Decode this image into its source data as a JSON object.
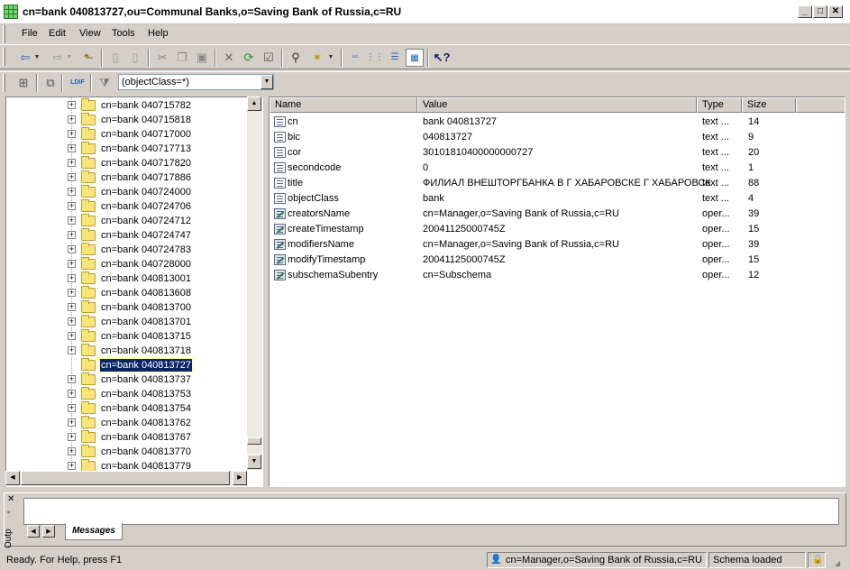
{
  "window": {
    "title": "cn=bank 040813727,ou=Communal Banks,o=Saving Bank of Russia,c=RU"
  },
  "menu": [
    {
      "label": "File"
    },
    {
      "label": "Edit"
    },
    {
      "label": "View"
    },
    {
      "label": "Tools"
    },
    {
      "label": "Help"
    }
  ],
  "filter": {
    "value": "(objectClass=*)",
    "ldif_label": "LDIF"
  },
  "tree": {
    "items": [
      {
        "label": "cn=bank 040715782"
      },
      {
        "label": "cn=bank 040715818"
      },
      {
        "label": "cn=bank 040717000"
      },
      {
        "label": "cn=bank 040717713"
      },
      {
        "label": "cn=bank 040717820"
      },
      {
        "label": "cn=bank 040717886"
      },
      {
        "label": "cn=bank 040724000"
      },
      {
        "label": "cn=bank 040724706"
      },
      {
        "label": "cn=bank 040724712"
      },
      {
        "label": "cn=bank 040724747"
      },
      {
        "label": "cn=bank 040724783"
      },
      {
        "label": "cn=bank 040728000"
      },
      {
        "label": "cn=bank 040813001"
      },
      {
        "label": "cn=bank 040813608"
      },
      {
        "label": "cn=bank 040813700"
      },
      {
        "label": "cn=bank 040813701"
      },
      {
        "label": "cn=bank 040813715"
      },
      {
        "label": "cn=bank 040813718"
      },
      {
        "label": "cn=bank 040813727",
        "selected": true
      },
      {
        "label": "cn=bank 040813737"
      },
      {
        "label": "cn=bank 040813753"
      },
      {
        "label": "cn=bank 040813754"
      },
      {
        "label": "cn=bank 040813762"
      },
      {
        "label": "cn=bank 040813767"
      },
      {
        "label": "cn=bank 040813770"
      },
      {
        "label": "cn=bank 040813779"
      }
    ]
  },
  "list": {
    "columns": [
      "Name",
      "Value",
      "Type",
      "Size"
    ],
    "rows": [
      {
        "name": "cn",
        "value": "bank 040813727",
        "type": "text ...",
        "size": "14",
        "icon": "text-attr-icon"
      },
      {
        "name": "bic",
        "value": "040813727",
        "type": "text ...",
        "size": "9",
        "icon": "text-attr-icon"
      },
      {
        "name": "cor",
        "value": "30101810400000000727",
        "type": "text ...",
        "size": "20",
        "icon": "text-attr-icon"
      },
      {
        "name": "secondcode",
        "value": "0",
        "type": "text ...",
        "size": "1",
        "icon": "text-attr-icon"
      },
      {
        "name": "title",
        "value": "ФИЛИАЛ ВНЕШТОРГБАНКА В Г ХАБАРОВСКЕ Г ХАБАРОВСК",
        "type": "text ...",
        "size": "88",
        "icon": "text-attr-icon"
      },
      {
        "name": "objectClass",
        "value": "bank",
        "type": "text ...",
        "size": "4",
        "icon": "text-attr-icon"
      },
      {
        "name": "creatorsName",
        "value": "cn=Manager,o=Saving Bank of Russia,c=RU",
        "type": "oper...",
        "size": "39",
        "icon": "operational-attr-icon"
      },
      {
        "name": "createTimestamp",
        "value": "20041125000745Z",
        "type": "oper...",
        "size": "15",
        "icon": "operational-attr-icon"
      },
      {
        "name": "modifiersName",
        "value": "cn=Manager,o=Saving Bank of Russia,c=RU",
        "type": "oper...",
        "size": "39",
        "icon": "operational-attr-icon"
      },
      {
        "name": "modifyTimestamp",
        "value": "20041125000745Z",
        "type": "oper...",
        "size": "15",
        "icon": "operational-attr-icon"
      },
      {
        "name": "subschemaSubentry",
        "value": "cn=Subschema",
        "type": "oper...",
        "size": "12",
        "icon": "operational-attr-icon"
      }
    ]
  },
  "messages": {
    "tab_label": "Messages",
    "panel_label": "Outp"
  },
  "status": {
    "help": "Ready. For Help, press F1",
    "user": "cn=Manager,o=Saving Bank of Russia,c=RU",
    "schema": "Schema loaded"
  }
}
